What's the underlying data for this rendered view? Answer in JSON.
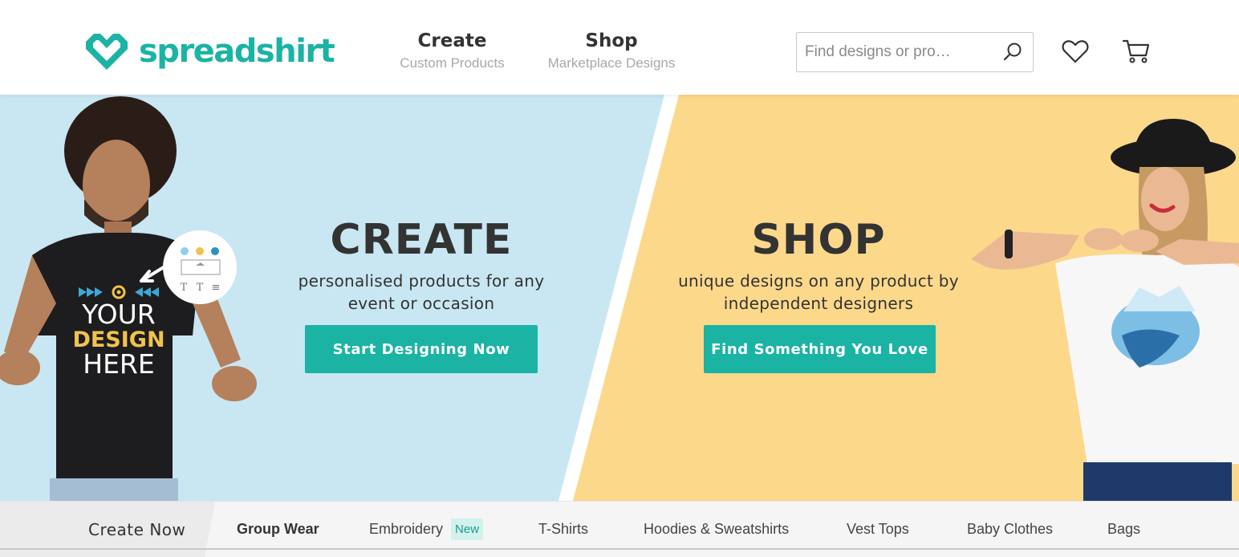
{
  "brand": {
    "name": "spreadshirt",
    "color": "#1bb3a4"
  },
  "nav": {
    "create": {
      "title": "Create",
      "subtitle": "Custom Products"
    },
    "shop": {
      "title": "Shop",
      "subtitle": "Marketplace Designs"
    }
  },
  "search": {
    "placeholder": "Find designs or pro…",
    "value": "",
    "icon": "search-icon"
  },
  "header_icons": {
    "wishlist": "heart-icon",
    "cart": "cart-icon"
  },
  "hero": {
    "create": {
      "title": "CREATE",
      "subtitle_line1": "personalised products for any",
      "subtitle_line2": "event or occasion",
      "button": "Start Designing Now",
      "background": "#c8e7f2"
    },
    "shop": {
      "title": "SHOP",
      "subtitle_line1": "unique designs on any product by",
      "subtitle_line2": "independent designers",
      "button": "Find Something You Love",
      "background": "#fcd88b"
    },
    "tshirt_print": {
      "line1": "YOUR",
      "line2": "DESIGN",
      "line3": "HERE"
    },
    "editor_bubble_tools": [
      "T",
      "T",
      "≡"
    ]
  },
  "bottom_nav": {
    "create_now": "Create Now",
    "categories": [
      {
        "label": "Group Wear",
        "bold": true
      },
      {
        "label": "Embroidery",
        "badge": "New"
      },
      {
        "label": "T-Shirts"
      },
      {
        "label": "Hoodies & Sweatshirts"
      },
      {
        "label": "Vest Tops"
      },
      {
        "label": "Baby Clothes"
      },
      {
        "label": "Bags"
      }
    ]
  }
}
